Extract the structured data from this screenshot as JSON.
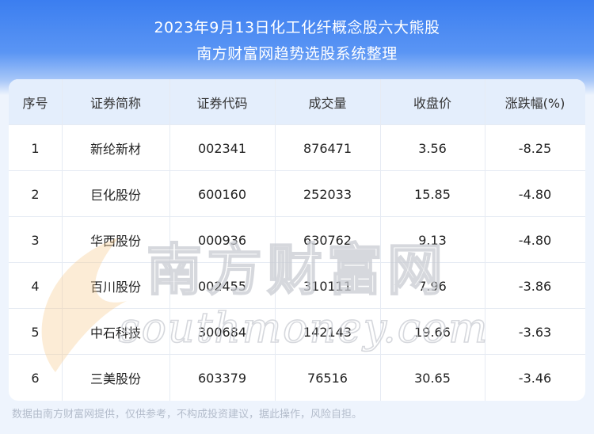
{
  "header": {
    "title_line1": "2023年9月13日化工化纤概念股六大熊股",
    "title_line2": "南方财富网趋势选股系统整理"
  },
  "table": {
    "columns": [
      "序号",
      "证券简称",
      "证券代码",
      "成交量",
      "收盘价",
      "涨跌幅(%)"
    ],
    "rows": [
      [
        "1",
        "新纶新材",
        "002341",
        "876471",
        "3.56",
        "-8.25"
      ],
      [
        "2",
        "巨化股份",
        "600160",
        "252033",
        "15.85",
        "-4.80"
      ],
      [
        "3",
        "华西股份",
        "000936",
        "630762",
        "9.13",
        "-4.80"
      ],
      [
        "4",
        "百川股份",
        "002455",
        "310111",
        "7.96",
        "-3.86"
      ],
      [
        "5",
        "中石科技",
        "300684",
        "142143",
        "19.66",
        "-3.63"
      ],
      [
        "6",
        "三美股份",
        "603379",
        "76516",
        "30.65",
        "-3.46"
      ]
    ]
  },
  "watermark": {
    "cn": "南方财富网",
    "en": "southmoney.com"
  },
  "footer": {
    "disclaimer": "数据由南方财富网提供，仅供参考，不构成投资建议，据此操作，风险自担。"
  }
}
